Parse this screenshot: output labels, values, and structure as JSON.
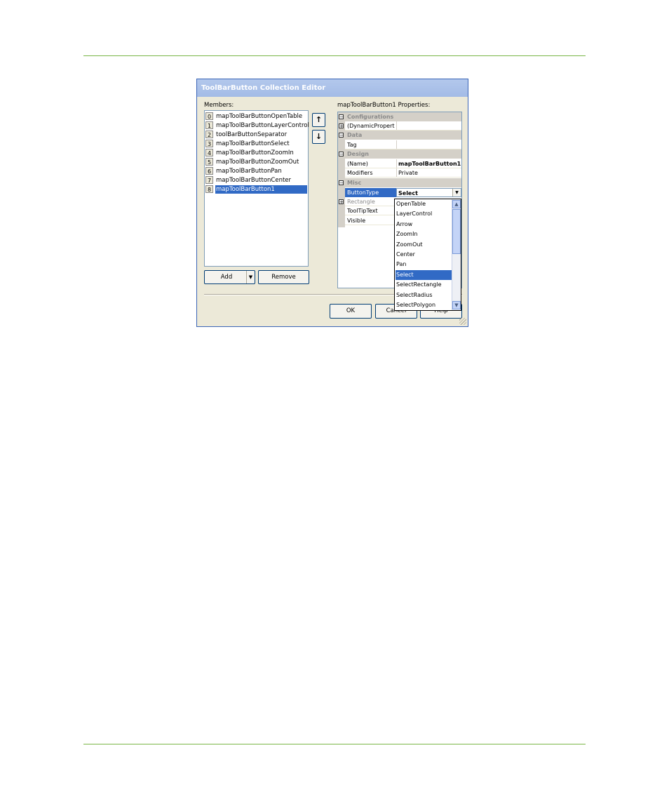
{
  "dialog": {
    "title": "ToolBarButton Collection Editor",
    "members_label": "Members:",
    "properties_label": "mapToolBarButton1 Properties:",
    "members": [
      {
        "index": "0",
        "name": "mapToolBarButtonOpenTable"
      },
      {
        "index": "1",
        "name": "mapToolBarButtonLayerControl"
      },
      {
        "index": "2",
        "name": "toolBarButtonSeparator"
      },
      {
        "index": "3",
        "name": "mapToolBarButtonSelect"
      },
      {
        "index": "4",
        "name": "mapToolBarButtonZoomIn"
      },
      {
        "index": "5",
        "name": "mapToolBarButtonZoomOut"
      },
      {
        "index": "6",
        "name": "mapToolBarButtonPan"
      },
      {
        "index": "7",
        "name": "mapToolBarButtonCenter"
      },
      {
        "index": "8",
        "name": "mapToolBarButton1"
      }
    ],
    "selected_member_index": 8,
    "add_label": "Add",
    "remove_label": "Remove",
    "ok_label": "OK",
    "cancel_label": "Cancel",
    "help_label": "Help",
    "properties": {
      "cat_configurations": "Configurations",
      "dynamic_properties": "(DynamicProperties)",
      "cat_data": "Data",
      "tag": "Tag",
      "cat_design": "Design",
      "name_key": "(Name)",
      "name_value": "mapToolBarButton1",
      "modifiers_key": "Modifiers",
      "modifiers_value": "Private",
      "cat_misc": "Misc",
      "buttontype_key": "ButtonType",
      "buttontype_value": "Select",
      "rectangle_key": "Rectangle",
      "tooltiptext_key": "ToolTipText",
      "visible_key": "Visible"
    },
    "dropdown_items": [
      "OpenTable",
      "LayerControl",
      "Arrow",
      "ZoomIn",
      "ZoomOut",
      "Center",
      "Pan",
      "Select",
      "SelectRectangle",
      "SelectRadius",
      "SelectPolygon"
    ],
    "dropdown_selected": "Select"
  },
  "colors": {
    "selection": "#316ac5",
    "rule": "#7ab648",
    "dialog_bg": "#ece9d8"
  }
}
